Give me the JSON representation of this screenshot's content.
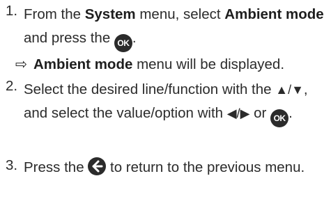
{
  "steps": [
    {
      "number": "1.",
      "parts": {
        "a": "From the ",
        "b": "System",
        "c": " menu, select ",
        "d": "Ambient mode",
        "e": " and press the ",
        "ok": "OK",
        "f": "."
      }
    },
    {
      "number": "2.",
      "parts": {
        "a": "Select the desired line/function with the ",
        "up_down": "▲/▼",
        "b": ", and select the value/option with ",
        "left_right": "◀/▶",
        "c": " or ",
        "ok": "OK",
        "d": "."
      }
    },
    {
      "number": "3.",
      "parts": {
        "a": "Press the ",
        "b": " to return to the previous menu."
      }
    }
  ],
  "result": {
    "arrow": "⇨",
    "bold": "Ambient mode",
    "rest": " menu will be displayed."
  },
  "icons": {
    "ok": "ok-button-icon",
    "back": "back-arrow-icon"
  }
}
